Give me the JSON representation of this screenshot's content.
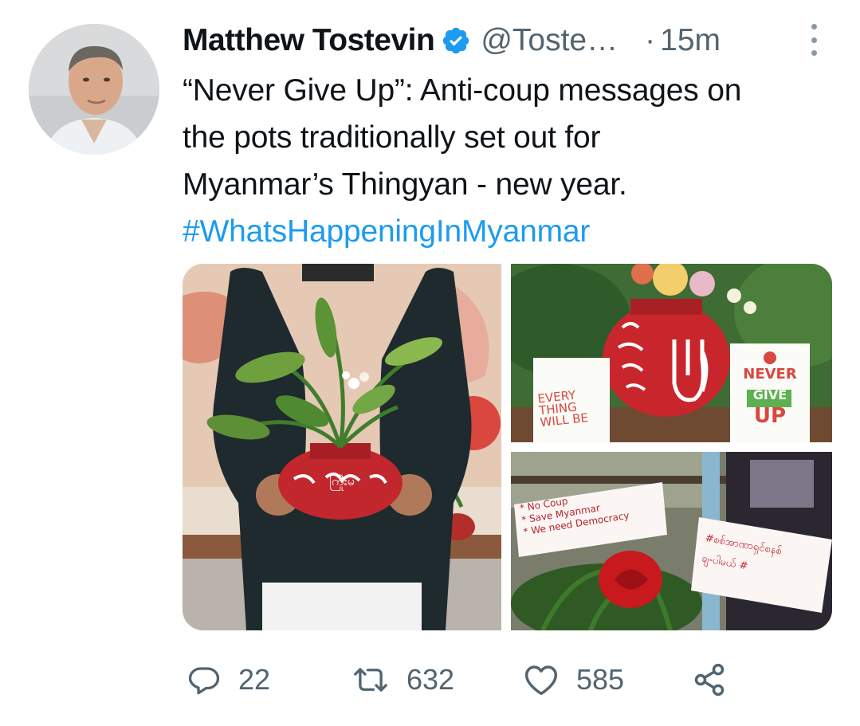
{
  "tweet": {
    "author_name": "Matthew Tostevin",
    "handle": "@Toste…",
    "separator": "·",
    "time": "15m",
    "text_lines": [
      "“Never Give Up”: Anti-coup messages on",
      "the pots traditionally set out for",
      "Myanmar’s Thingyan - new year."
    ],
    "hashtag": "#WhatsHappeningInMyanmar"
  },
  "media": {
    "pot_label": "ကြိုးမ",
    "card_left": [
      "EVERY",
      "THING",
      "WILL BE"
    ],
    "card_right": [
      "NEVER",
      "GIVE",
      "UP"
    ],
    "sign_left": [
      "* No Coup",
      "* Save Myanmar",
      "* We need Democracy"
    ],
    "sign_right": [
      "#စစ်အာဏာရှင်စနစ်",
      "ချ-ပါမယ် #"
    ]
  },
  "actions": {
    "reply_count": "22",
    "retweet_count": "632",
    "like_count": "585"
  },
  "icons": {
    "verified": "verified-badge-icon",
    "more": "more-options-icon",
    "reply": "reply-icon",
    "retweet": "retweet-icon",
    "like": "heart-icon",
    "share": "share-icon"
  },
  "colors": {
    "accent": "#1d9bf0",
    "secondary_text": "#536471",
    "primary_text": "#0f1419"
  }
}
